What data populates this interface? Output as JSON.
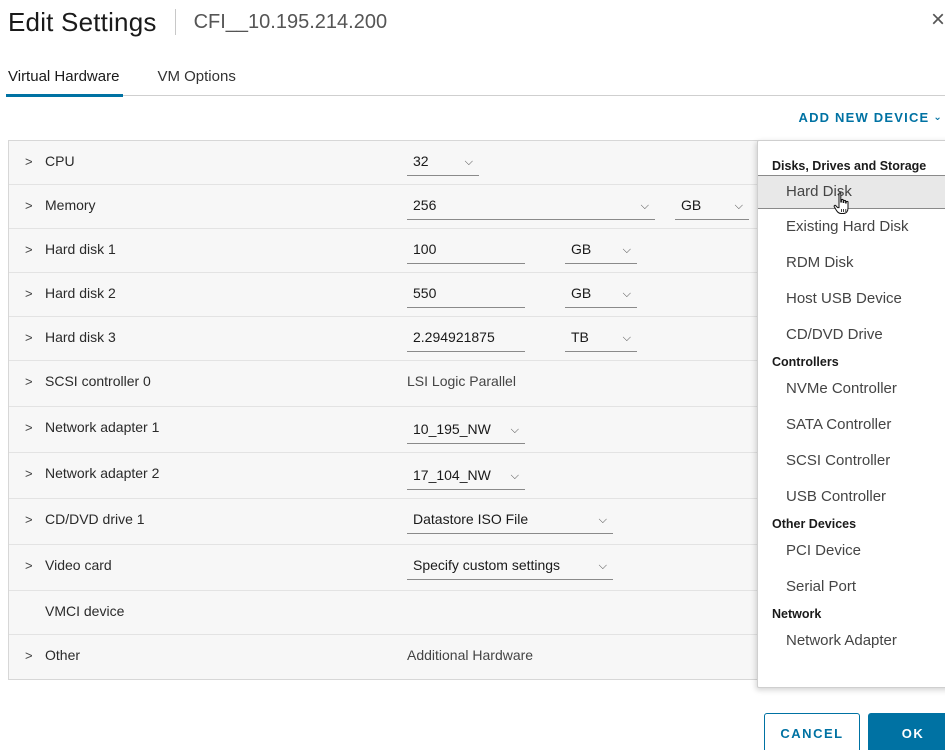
{
  "header": {
    "title": "Edit Settings",
    "vm_name": "CFI__10.195.214.200",
    "close_glyph": "×"
  },
  "tabs": [
    {
      "label": "Virtual Hardware",
      "active": true
    },
    {
      "label": "VM Options",
      "active": false
    }
  ],
  "add_device": {
    "label": "ADD NEW DEVICE",
    "chevron": "⌄"
  },
  "hardware": {
    "cpu": {
      "label": "CPU",
      "value": "32"
    },
    "memory": {
      "label": "Memory",
      "value": "256",
      "unit": "GB"
    },
    "hard_disk_1": {
      "label": "Hard disk 1",
      "value": "100",
      "unit": "GB"
    },
    "hard_disk_2": {
      "label": "Hard disk 2",
      "value": "550",
      "unit": "GB"
    },
    "hard_disk_3": {
      "label": "Hard disk 3",
      "value": "2.294921875",
      "unit": "TB"
    },
    "scsi": {
      "label": "SCSI controller 0",
      "value": "LSI Logic Parallel"
    },
    "net1": {
      "label": "Network adapter 1",
      "value": "10_195_NW"
    },
    "net2": {
      "label": "Network adapter 2",
      "value": "17_104_NW"
    },
    "cddvd": {
      "label": "CD/DVD drive 1",
      "value": "Datastore ISO File"
    },
    "video": {
      "label": "Video card",
      "value": "Specify custom settings"
    },
    "vmci": {
      "label": "VMCI device"
    },
    "other": {
      "label": "Other",
      "value": "Additional Hardware"
    }
  },
  "menu": {
    "group_disks": "Disks, Drives and Storage",
    "hard_disk": "Hard Disk",
    "existing_hard_disk": "Existing Hard Disk",
    "rdm_disk": "RDM Disk",
    "host_usb_device": "Host USB Device",
    "cd_dvd_drive": "CD/DVD Drive",
    "group_controllers": "Controllers",
    "nvme_controller": "NVMe Controller",
    "sata_controller": "SATA Controller",
    "scsi_controller": "SCSI Controller",
    "usb_controller": "USB Controller",
    "group_other": "Other Devices",
    "pci_device": "PCI Device",
    "serial_port": "Serial Port",
    "group_network": "Network",
    "network_adapter": "Network Adapter"
  },
  "footer": {
    "cancel": "CANCEL",
    "ok": "OK"
  },
  "colors": {
    "accent": "#0072a3"
  }
}
